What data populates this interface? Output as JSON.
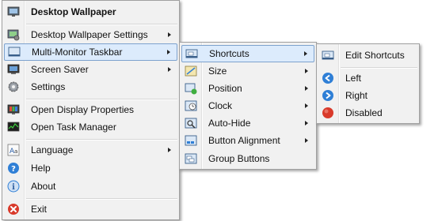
{
  "main_menu": {
    "items": [
      {
        "label": "Desktop Wallpaper",
        "icon": "wallpaper-icon",
        "submenu": false
      },
      {
        "label": "Desktop Wallpaper Settings",
        "icon": "wallpaper-settings-icon",
        "submenu": true
      },
      {
        "label": "Multi-Monitor Taskbar",
        "icon": "taskbar-icon",
        "submenu": true
      },
      {
        "label": "Screen Saver",
        "icon": "monitor-icon",
        "submenu": true
      },
      {
        "label": "Settings",
        "icon": "gear-icon",
        "submenu": false
      },
      {
        "label": "Open Display Properties",
        "icon": "display-properties-icon",
        "submenu": false
      },
      {
        "label": "Open Task Manager",
        "icon": "task-manager-icon",
        "submenu": false
      },
      {
        "label": "Language",
        "icon": "language-icon",
        "submenu": true
      },
      {
        "label": "Help",
        "icon": "help-icon",
        "submenu": false
      },
      {
        "label": "About",
        "icon": "info-icon",
        "submenu": false
      },
      {
        "label": "Exit",
        "icon": "exit-icon",
        "submenu": false
      }
    ]
  },
  "taskbar_menu": {
    "items": [
      {
        "label": "Shortcuts",
        "icon": "shortcuts-icon",
        "submenu": true
      },
      {
        "label": "Size",
        "icon": "size-icon",
        "submenu": true
      },
      {
        "label": "Position",
        "icon": "position-icon",
        "submenu": true
      },
      {
        "label": "Clock",
        "icon": "clock-icon",
        "submenu": true
      },
      {
        "label": "Auto-Hide",
        "icon": "auto-hide-icon",
        "submenu": true
      },
      {
        "label": "Button Alignment",
        "icon": "button-alignment-icon",
        "submenu": true
      },
      {
        "label": "Group Buttons",
        "icon": "group-buttons-icon",
        "submenu": false
      }
    ]
  },
  "shortcuts_menu": {
    "items": [
      {
        "label": "Edit Shortcuts",
        "icon": "edit-shortcuts-icon"
      },
      {
        "label": "Left",
        "icon": "arrow-left-icon"
      },
      {
        "label": "Right",
        "icon": "arrow-right-icon"
      },
      {
        "label": "Disabled",
        "icon": "disabled-icon"
      }
    ]
  },
  "colors": {
    "menu_background": "#f1f1f1",
    "highlight": "#dcebfc",
    "highlight_border": "#7da2ce",
    "blue_accent": "#2f7fd6",
    "red_accent": "#d93a2b"
  }
}
